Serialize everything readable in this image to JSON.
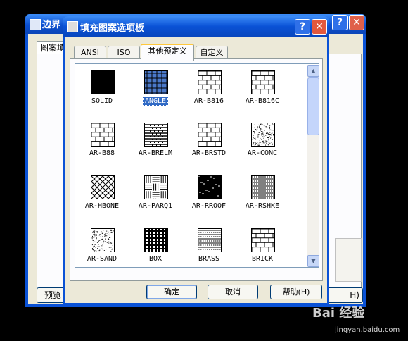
{
  "back_window": {
    "title": "边界",
    "tab_label": "图案填",
    "preview_label": "预览",
    "help_label": "H)",
    "help_glyph": "?",
    "close_glyph": "✕"
  },
  "dialog": {
    "title": "填充图案选项板",
    "help_glyph": "?",
    "close_glyph": "✕",
    "tabs": [
      {
        "label": "ANSI",
        "active": false
      },
      {
        "label": "ISO",
        "active": false
      },
      {
        "label": "其他预定义",
        "active": true
      },
      {
        "label": "自定义",
        "active": false
      }
    ],
    "patterns": [
      {
        "name": "SOLID",
        "selected": false
      },
      {
        "name": "ANGLE",
        "selected": true
      },
      {
        "name": "AR-B816",
        "selected": false
      },
      {
        "name": "AR-B816C",
        "selected": false
      },
      {
        "name": "AR-B88",
        "selected": false
      },
      {
        "name": "AR-BRELM",
        "selected": false
      },
      {
        "name": "AR-BRSTD",
        "selected": false
      },
      {
        "name": "AR-CONC",
        "selected": false
      },
      {
        "name": "AR-HBONE",
        "selected": false
      },
      {
        "name": "AR-PARQ1",
        "selected": false
      },
      {
        "name": "AR-RROOF",
        "selected": false
      },
      {
        "name": "AR-RSHKE",
        "selected": false
      },
      {
        "name": "AR-SAND",
        "selected": false
      },
      {
        "name": "BOX",
        "selected": false
      },
      {
        "name": "BRASS",
        "selected": false
      },
      {
        "name": "BRICK",
        "selected": false
      }
    ],
    "buttons": {
      "ok": "确定",
      "cancel": "取消",
      "help": "帮助(H)"
    }
  },
  "watermark": {
    "brand": "Bai 经验",
    "url": "jingyan.baidu.com"
  },
  "colors": {
    "title_blue": "#0a52d6",
    "selection": "#316ac5",
    "face": "#ece9d8"
  }
}
